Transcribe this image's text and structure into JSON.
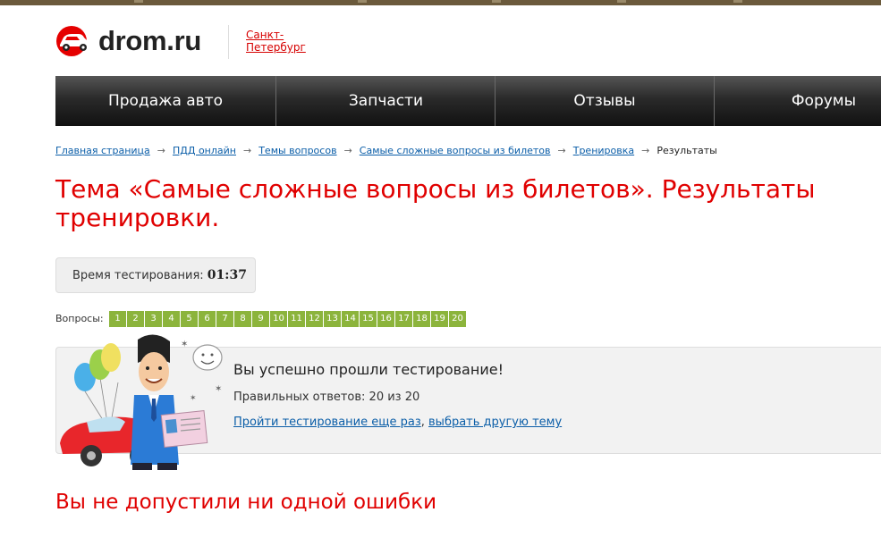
{
  "header": {
    "logo_text": "drom.ru",
    "city_link": "Санкт-Петербург"
  },
  "nav": {
    "items": [
      "Продажа авто",
      "Запчасти",
      "Отзывы",
      "Форумы"
    ]
  },
  "breadcrumb": {
    "links": [
      "Главная страница",
      "ПДД онлайн",
      "Темы вопросов",
      "Самые сложные вопросы из билетов",
      "Тренировка"
    ],
    "current": "Результаты",
    "separator": "→"
  },
  "page_title": "Тема «Самые сложные вопросы из билетов». Результаты тренировки.",
  "timer": {
    "label": "Время тестирования:",
    "value": "01:37"
  },
  "questions": {
    "label": "Вопросы:",
    "numbers": [
      "1",
      "2",
      "3",
      "4",
      "5",
      "6",
      "7",
      "8",
      "9",
      "10",
      "11",
      "12",
      "13",
      "14",
      "15",
      "16",
      "17",
      "18",
      "19",
      "20"
    ],
    "correct_color": "#8cb43c"
  },
  "result": {
    "title": "Вы успешно прошли тестирование!",
    "correct_answers": "Правильных ответов: 20 из 20",
    "retry_link": "Пройти тестирование еще раз",
    "comma": ", ",
    "other_topic_link": "выбрать другую тему"
  },
  "summary": "Вы не допустили ни одной ошибки",
  "colors": {
    "accent_red": "#e00000",
    "link_blue": "#0b5ea8",
    "nav_dark": "#1a1a1a"
  }
}
